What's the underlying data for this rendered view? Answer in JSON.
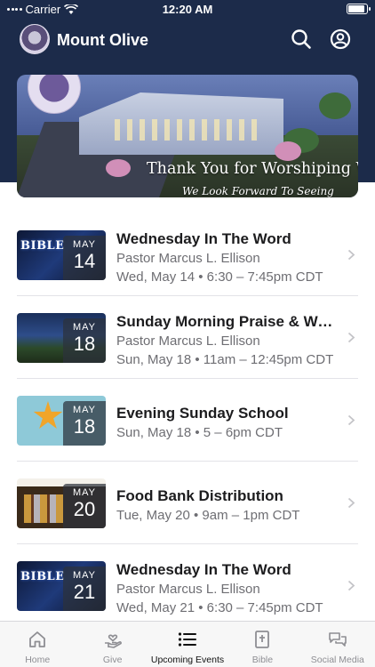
{
  "status_bar": {
    "carrier": "Carrier",
    "time": "12:20 AM"
  },
  "header": {
    "church_name": "Mount Olive"
  },
  "banner": {
    "title": "Thank You for Worshiping With Us!",
    "subtitle": "We Look Forward To Seeing"
  },
  "events": [
    {
      "thumb_label": "BIBLE",
      "month": "MAY",
      "day": "14",
      "title": "Wednesday In The Word",
      "line1": "Pastor Marcus L. Ellison",
      "line2": "Wed, May 14 • 6:30 – 7:45pm CDT"
    },
    {
      "thumb_label": "",
      "month": "MAY",
      "day": "18",
      "title": "Sunday Morning Praise & Wor...",
      "line1": "Pastor Marcus L. Ellison",
      "line2": "Sun, May 18 • 11am – 12:45pm CDT"
    },
    {
      "thumb_label": "",
      "month": "MAY",
      "day": "18",
      "title": "Evening Sunday School",
      "line1": "Sun, May 18 • 5 – 6pm CDT",
      "line2": ""
    },
    {
      "thumb_label": "",
      "month": "MAY",
      "day": "20",
      "title": "Food Bank Distribution",
      "line1": "Tue, May 20 • 9am – 1pm CDT",
      "line2": ""
    },
    {
      "thumb_label": "BIBLE",
      "month": "MAY",
      "day": "21",
      "title": "Wednesday In The Word",
      "line1": "Pastor Marcus L. Ellison",
      "line2": "Wed, May 21 • 6:30 – 7:45pm CDT"
    }
  ],
  "tabs": [
    {
      "label": "Home",
      "icon": "home-icon"
    },
    {
      "label": "Give",
      "icon": "give-icon"
    },
    {
      "label": "Upcoming Events",
      "icon": "list-icon",
      "active": true
    },
    {
      "label": "Bible",
      "icon": "bible-icon"
    },
    {
      "label": "Social Media",
      "icon": "chat-icon"
    }
  ],
  "colors": {
    "header_bg": "#1c2b4a",
    "active_tab": "#111111",
    "inactive_tab": "#8e8e93"
  }
}
